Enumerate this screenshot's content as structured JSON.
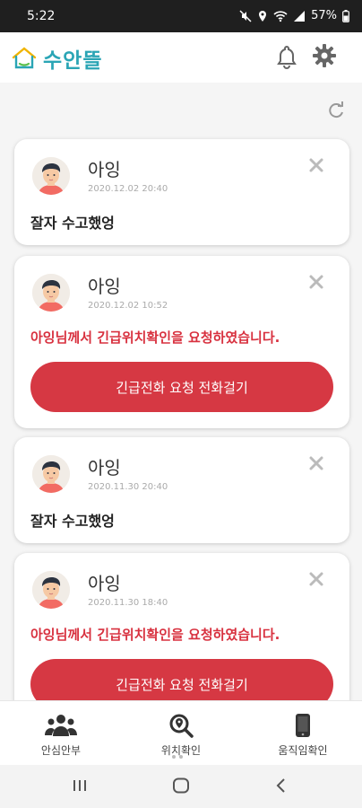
{
  "status": {
    "time": "5:22",
    "battery": "57%"
  },
  "app": {
    "title": "수안뜰"
  },
  "notifications": [
    {
      "name": "아잉",
      "date": "2020.12.02 20:40",
      "message": "잘자 수고했엉",
      "type": "message"
    },
    {
      "name": "아잉",
      "date": "2020.12.02 10:52",
      "message": "아잉님께서 긴급위치확인을 요청하였습니다.",
      "type": "alert",
      "button": "긴급전화 요청 전화걸기"
    },
    {
      "name": "아잉",
      "date": "2020.11.30 20:40",
      "message": "잘자 수고했엉",
      "type": "message"
    },
    {
      "name": "아잉",
      "date": "2020.11.30 18:40",
      "message": "아잉님께서 긴급위치확인을 요청하였습니다.",
      "type": "alert",
      "button": "긴급전화 요청 전화걸기"
    }
  ],
  "nav": [
    {
      "label": "안심안부",
      "icon": "users-icon"
    },
    {
      "label": "위치확인",
      "icon": "location-search-icon"
    },
    {
      "label": "움직임확인",
      "icon": "phone-device-icon"
    }
  ],
  "colors": {
    "brand": "#2aa5b5",
    "alert": "#d8313f",
    "button": "#d63843"
  }
}
